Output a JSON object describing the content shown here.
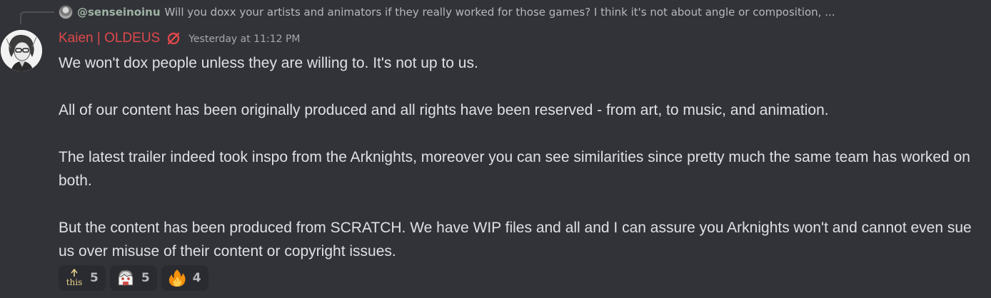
{
  "reply": {
    "username": "@senseinoinu",
    "text": "Will you doxx your artists and animators if they really worked for those games? I think it's not about angle or composition, ..."
  },
  "message": {
    "author": "Kaien | OLDEUS",
    "timestamp": "Yesterday at 11:12 PM",
    "author_color": "#e0484a",
    "paragraphs": [
      "We won't dox people unless they are willing to. It's not up to us.",
      "All of our content has been originally produced and all rights have been reserved - from art, to music, and animation.",
      "The latest trailer indeed took inspo from the Arknights, moreover you can see similarities since pretty much the same team has worked on both.",
      "But the content has been produced from SCRATCH. We have WIP files and all and I can assure you Arknights won't and cannot even sue us over misuse of their content or copyright issues."
    ]
  },
  "reactions": [
    {
      "emoji": "this-up-arrow-emoji",
      "emoji_text": "this",
      "count": "5"
    },
    {
      "emoji": "anime-face-emoji",
      "count": "5"
    },
    {
      "emoji": "fire-emoji",
      "count": "4"
    }
  ]
}
